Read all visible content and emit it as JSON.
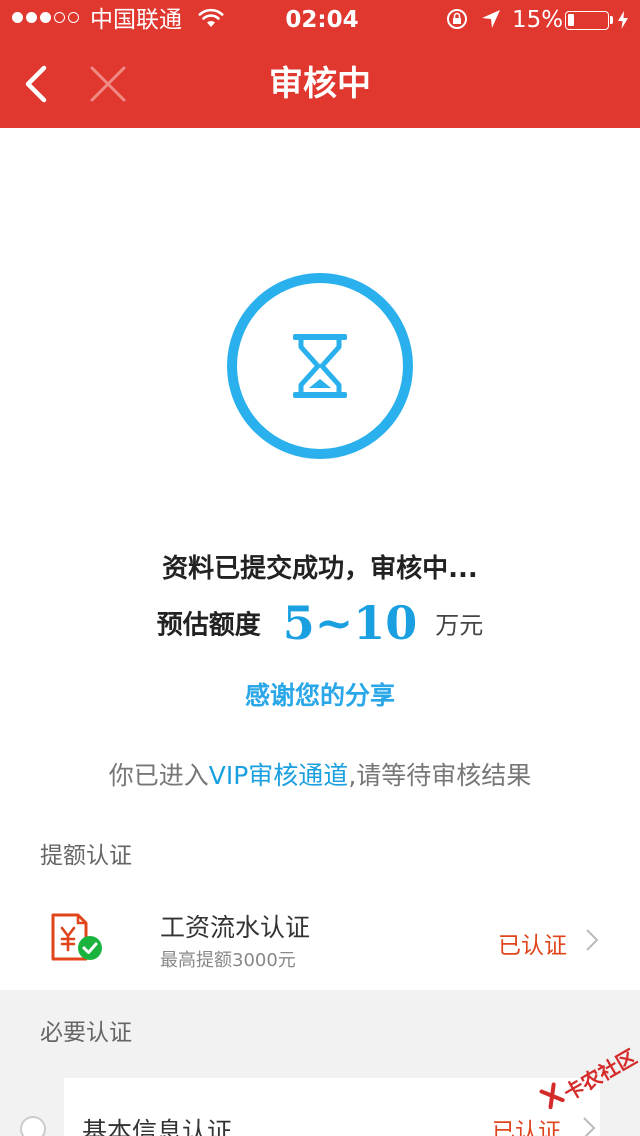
{
  "status_bar": {
    "carrier": "中国联通",
    "time": "02:04",
    "battery_percent": "15%",
    "battery_level": 0.15
  },
  "nav": {
    "title": "审核中",
    "back_icon": "chevron-left-icon",
    "close_icon": "close-icon"
  },
  "status": {
    "icon": "hourglass-icon",
    "message": "资料已提交成功，审核中...",
    "quota_label": "预估额度",
    "quota_value": "5~10",
    "quota_unit": "万元",
    "thanks_link": "感谢您的分享"
  },
  "vip": {
    "prefix": "你已进入",
    "highlight": "VIP审核通道",
    "suffix": ",请等待审核结果"
  },
  "sections": {
    "limit_cert_title": "提额认证",
    "required_cert_title": "必要认证"
  },
  "limit_items": [
    {
      "name": "工资流水认证",
      "sub": "最高提额3000元",
      "status": "已认证",
      "icon": "salary-document-check-icon"
    }
  ],
  "required_items": [
    {
      "name": "基本信息认证",
      "status": "已认证"
    }
  ],
  "watermark": {
    "text": "卡农社区"
  },
  "colors": {
    "brand_red": "#e0372f",
    "accent_blue": "#1a9fe0",
    "status_orange": "#e0451c",
    "success_green": "#1ab33e"
  }
}
